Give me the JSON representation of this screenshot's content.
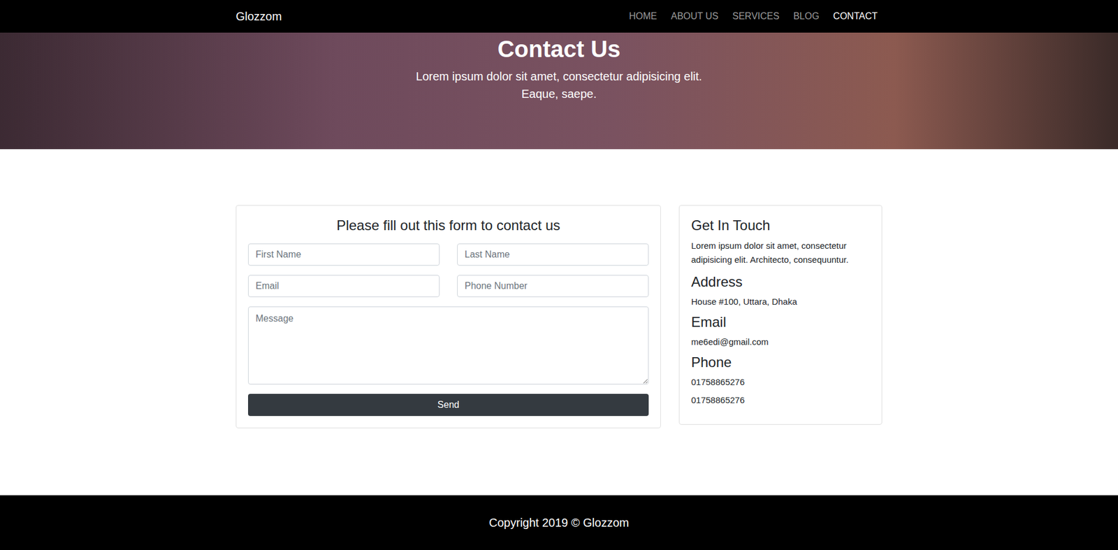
{
  "navbar": {
    "brand": "Glozzom",
    "links": [
      {
        "label": "HOME",
        "selected": false
      },
      {
        "label": "ABOUT US",
        "selected": false
      },
      {
        "label": "SERVICES",
        "selected": false
      },
      {
        "label": "BLOG",
        "selected": false
      },
      {
        "label": "CONTACT",
        "selected": true
      }
    ]
  },
  "hero": {
    "title": "Contact Us",
    "subtitle": "Lorem ipsum dolor sit amet, consectetur adipisicing elit. Eaque, saepe."
  },
  "form": {
    "heading": "Please fill out this form to contact us",
    "rows": [
      [
        "First Name",
        "Last Name"
      ],
      [
        "Email",
        "Phone Number"
      ]
    ],
    "message_placeholder": "Message",
    "button": "Send"
  },
  "info": {
    "title": "Get In Touch",
    "text": "Lorem ipsum dolor sit amet, consectetur adipisicing elit. Architecto, consequuntur.",
    "sections": [
      {
        "heading": "Address",
        "values": [
          "House #100, Uttara, Dhaka"
        ]
      },
      {
        "heading": "Email",
        "values": [
          "me6edi@gmail.com"
        ]
      },
      {
        "heading": "Phone",
        "values": [
          "01758865276",
          "01758865276"
        ]
      }
    ]
  },
  "footer": {
    "text": "Copyright 2019 © Glozzom"
  }
}
